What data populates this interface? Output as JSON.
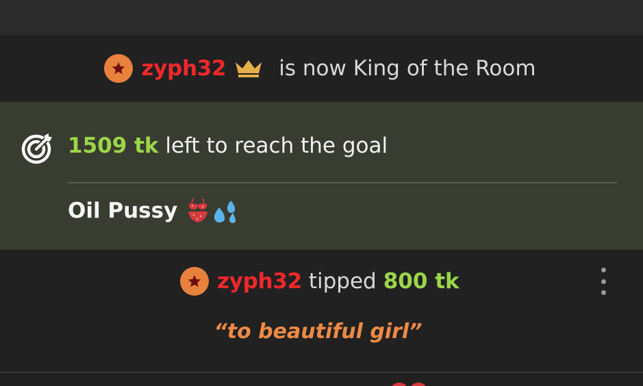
{
  "king_notice": {
    "username": "zyph32",
    "message": "is now King of the Room",
    "badge_icon": "star-badge-icon",
    "crown_icon": "crown-icon",
    "username_color": "#f0282b",
    "crown_color": "#e8b04a"
  },
  "goal": {
    "icon": "target-goal-icon",
    "amount": "1509 tk",
    "text": "left to reach the goal",
    "title": "Oil Pussy",
    "emojis": [
      "bikini-emoji-icon",
      "sweat-droplets-emoji-icon"
    ],
    "amount_color": "#9bd64a"
  },
  "tip": {
    "username": "zyph32",
    "verb": "tipped",
    "amount": "800 tk",
    "message": "“to beautiful girl”",
    "menu_icon": "more-vertical-icon",
    "message_color": "#ee8a45"
  },
  "next_item": {
    "icon": "heart-icon"
  }
}
